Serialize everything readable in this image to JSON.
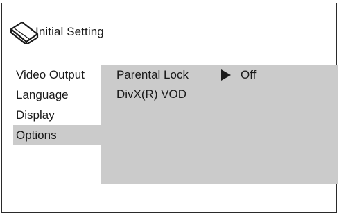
{
  "header": {
    "icon": "disc-case-icon",
    "title": "Initial Setting"
  },
  "sidebar": {
    "items": [
      {
        "label": "Video Output",
        "selected": false
      },
      {
        "label": "Language",
        "selected": false
      },
      {
        "label": "Display",
        "selected": false
      },
      {
        "label": "Options",
        "selected": true
      }
    ]
  },
  "options_panel": {
    "items": [
      {
        "label": "Parental Lock",
        "value": "Off",
        "pointer_icon": "right-triangle-icon"
      },
      {
        "label": "DivX(R) VOD"
      }
    ]
  },
  "colors": {
    "selection_background": "#cbcbcb",
    "border": "#2a2a2a",
    "text": "#1a1a1a"
  }
}
